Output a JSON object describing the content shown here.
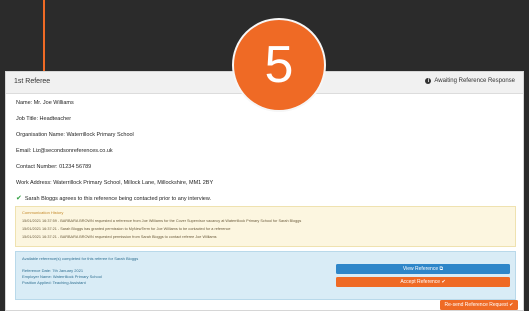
{
  "panel": {
    "title": "1st Referee",
    "status": "Awaiting Reference Response"
  },
  "fields": {
    "name": "Name: Mr. Joe Williams",
    "job_title": "Job Title: Headteacher",
    "organisation": "Organisation Name: Waterrillock Primary School",
    "email": "Email: Liz@secondsonreferences.co.uk",
    "contact": "Contact Number: 01234 56789",
    "address": "Work Address: Waterrillock Primary School, Millock Lane, Millockshire, MM1 2BY"
  },
  "agree_text": "Sarah Bloggs agrees to this reference being contacted prior to any interview.",
  "communications": {
    "title": "Communication History",
    "lines": [
      "15/01/2021 16:37:59 - BARBARA BROWN requested a reference from Joe Williams for the Cover Supervisor vacancy at Waterrillock Primary School for Sarah Bloggs",
      "15/01/2021 16:37:21 - Sarah Bloggs has granted permission to MyNewTerm for Joe Williams to be contacted for a reference",
      "15/01/2021 16:37:21 - BARBARA BROWN requested permission from Sarah Bloggs to contact referee Joe Williams"
    ]
  },
  "available": {
    "title": "Available reference(s) completed for this referee for Sarah Bloggs",
    "reference_date": "Reference Date: 7th January 2021",
    "employer": "Employer Name: Waterrillock Primary School",
    "position": "Position Applied: Teaching Assistant"
  },
  "buttons": {
    "view": "View Reference ⧉",
    "accept": "Accept Reference ✔",
    "resend": "Re-send Reference Request ✔"
  },
  "step_number": "5",
  "colors": {
    "accent_orange": "#ef6a25",
    "accent_blue": "#2e86c9",
    "comms_bg": "#fcf6e0",
    "info_bg": "#d9ecf6"
  }
}
